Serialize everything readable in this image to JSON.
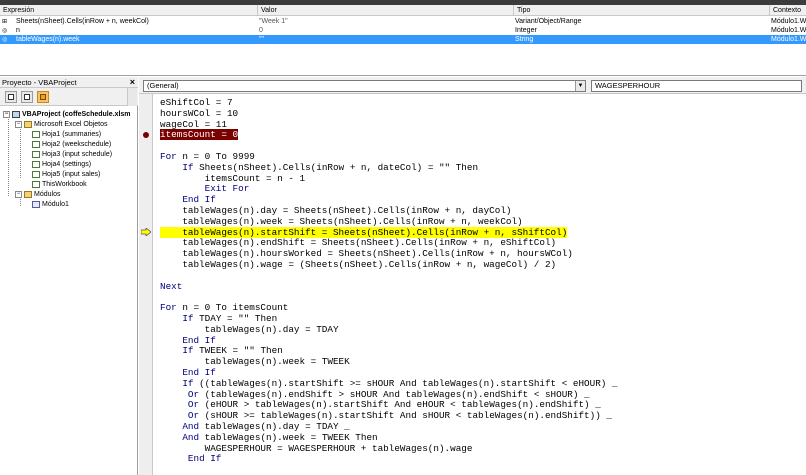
{
  "watch": {
    "columns": [
      "Expresión",
      "Valor",
      "Tipo",
      "Contexto"
    ],
    "rows": [
      {
        "icon": "watch-expand-icon",
        "expression": "Sheets(nSheet).Cells(inRow + n, weekCol)",
        "value": "\"Week 1\"",
        "type": "Variant/Object/Range",
        "context": "Módulo1.W",
        "selected": false
      },
      {
        "icon": "watch-glasses-icon",
        "expression": "n",
        "value": "0",
        "type": "Integer",
        "context": "Módulo1.W",
        "selected": false
      },
      {
        "icon": "watch-glasses-icon",
        "expression": "tableWages(n).week",
        "value": "\"\"",
        "type": "String",
        "context": "Módulo1.W",
        "selected": true
      }
    ]
  },
  "project": {
    "title": "Proyecto - VBAProject",
    "close": "×",
    "tree": {
      "root": "VBAProject (coffeSchedule.xlsm",
      "excel_objects": "Microsoft Excel Objetos",
      "sheets": [
        "Hoja1 (summaries)",
        "Hoja2 (weekschedule)",
        "Hoja3 (input schedule)",
        "Hoja4 (settings)",
        "Hoja5 (input sales)",
        "ThisWorkbook"
      ],
      "modules_folder": "Módulos",
      "modules": [
        "Módulo1"
      ]
    }
  },
  "code": {
    "object_combo": "(General)",
    "procedure_combo": "WAGESPERHOUR",
    "lines": [
      "eShiftCol = 7",
      "hoursWCol = 10",
      "wageCol = 11",
      "itemsCount = 0",
      "",
      "For n = 0 To 9999",
      "    If Sheets(nSheet).Cells(inRow + n, dateCol) = \"\" Then",
      "        itemsCount = n - 1",
      "        Exit For",
      "    End If",
      "    tableWages(n).day = Sheets(nSheet).Cells(inRow + n, dayCol)",
      "    tableWages(n).week = Sheets(nSheet).Cells(inRow + n, weekCol)",
      "    tableWages(n).startShift = Sheets(nSheet).Cells(inRow + n, sShiftCol)",
      "    tableWages(n).endShift = Sheets(nSheet).Cells(inRow + n, eShiftCol)",
      "    tableWages(n).hoursWorked = Sheets(nSheet).Cells(inRow + n, hoursWCol)",
      "    tableWages(n).wage = (Sheets(nSheet).Cells(inRow + n, wageCol) / 2)",
      "",
      "Next",
      "",
      "For n = 0 To itemsCount",
      "    If TDAY = \"\" Then",
      "        tableWages(n).day = TDAY",
      "    End If",
      "    If TWEEK = \"\" Then",
      "        tableWages(n).week = TWEEK",
      "    End If",
      "    If ((tableWages(n).startShift >= sHOUR And tableWages(n).startShift < eHOUR) _",
      "     Or (tableWages(n).endShift > sHOUR And tableWages(n).endShift < sHOUR) _",
      "     Or (eHOUR > tableWages(n).startShift And eHOUR < tableWages(n).endShift) _",
      "     Or (sHOUR >= tableWages(n).startShift And sHOUR < tableWages(n).endShift)) _",
      "    And tableWages(n).day = TDAY _",
      "    And tableWages(n).week = TWEEK Then",
      "        WAGESPERHOUR = WAGESPERHOUR + tableWages(n).wage",
      "     End If"
    ],
    "breakpoint_line": 3,
    "current_line": 12
  }
}
